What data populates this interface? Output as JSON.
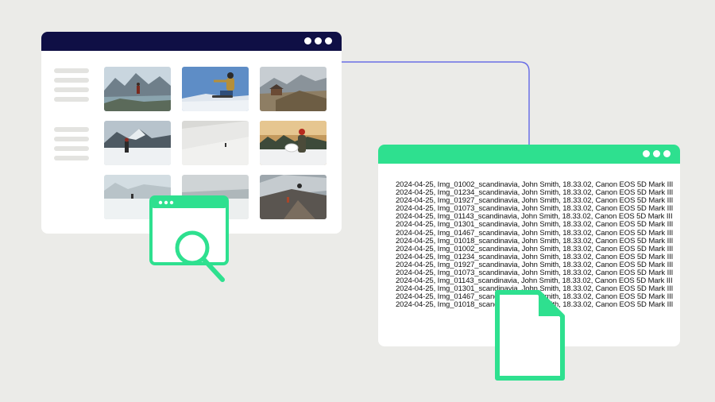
{
  "colors": {
    "background": "#ebebe8",
    "gallery_titlebar": "#0f0f45",
    "accent_green": "#2ee08f",
    "connector_line": "#6b6fe6",
    "window_bg": "#ffffff"
  },
  "gallery_window": {
    "titlebar_dots": 3,
    "sidebar_groups": 2,
    "thumbnails": [
      {
        "name": "lake-hiker-photo"
      },
      {
        "name": "snowboarder-jump-photo"
      },
      {
        "name": "mountain-cabin-photo"
      },
      {
        "name": "snowy-peak-hiker-photo"
      },
      {
        "name": "snow-slope-skier-photo"
      },
      {
        "name": "snowboarder-forest-photo"
      },
      {
        "name": "snow-ridge-hiker-photo"
      },
      {
        "name": "snow-plain-photo"
      },
      {
        "name": "cliff-climber-photo"
      }
    ],
    "icon": "window-with-magnifier-icon"
  },
  "log_window": {
    "titlebar_dots": 3,
    "lines": [
      "2024-04-25, Img_01002_scandinavia, John Smith, 18.33.02, Canon EOS 5D Mark III",
      "2024-04-25, Img_01234_scandinavia, John Smith, 18.33.02, Canon EOS 5D Mark III",
      "2024-04-25, Img_01927_scandinavia, John Smith, 18.33.02, Canon EOS 5D Mark III",
      "2024-04-25, Img_01073_scandinavia, John Smith, 18.33.02, Canon EOS 5D Mark III",
      "2024-04-25, Img_01143_scandinavia, John Smith, 18.33.02, Canon EOS 5D Mark III",
      "2024-04-25, Img_01301_scandinavia, John Smith, 18.33.02, Canon EOS 5D Mark III",
      "2024-04-25, Img_01467_scandinavia, John Smith, 18.33.02, Canon EOS 5D Mark III",
      "2024-04-25, Img_01018_scandinavia, John Smith, 18.33.02, Canon EOS 5D Mark III",
      "2024-04-25, Img_01002_scandinavia, John Smith, 18.33.02, Canon EOS 5D Mark III",
      "2024-04-25, Img_01234_scandinavia, John Smith, 18.33.02, Canon EOS 5D Mark III",
      "2024-04-25, Img_01927_scandinavia, John Smith, 18.33.02, Canon EOS 5D Mark III",
      "2024-04-25, Img_01073_scandinavia, John Smith, 18.33.02, Canon EOS 5D Mark III",
      "2024-04-25, Img_01143_scandinavia, John Smith, 18.33.02, Canon EOS 5D Mark III",
      "2024-04-25, Img_01301_scandinavia, John Smith, 18.33.02, Canon EOS 5D Mark III",
      "2024-04-25, Img_01467_scandinavia, John Smith, 18.33.02, Canon EOS 5D Mark III",
      "2024-04-25, Img_01018_scandinavia, John Smith, 18.33.02, Canon EOS 5D Mark III"
    ],
    "icon": "document-file-icon"
  }
}
